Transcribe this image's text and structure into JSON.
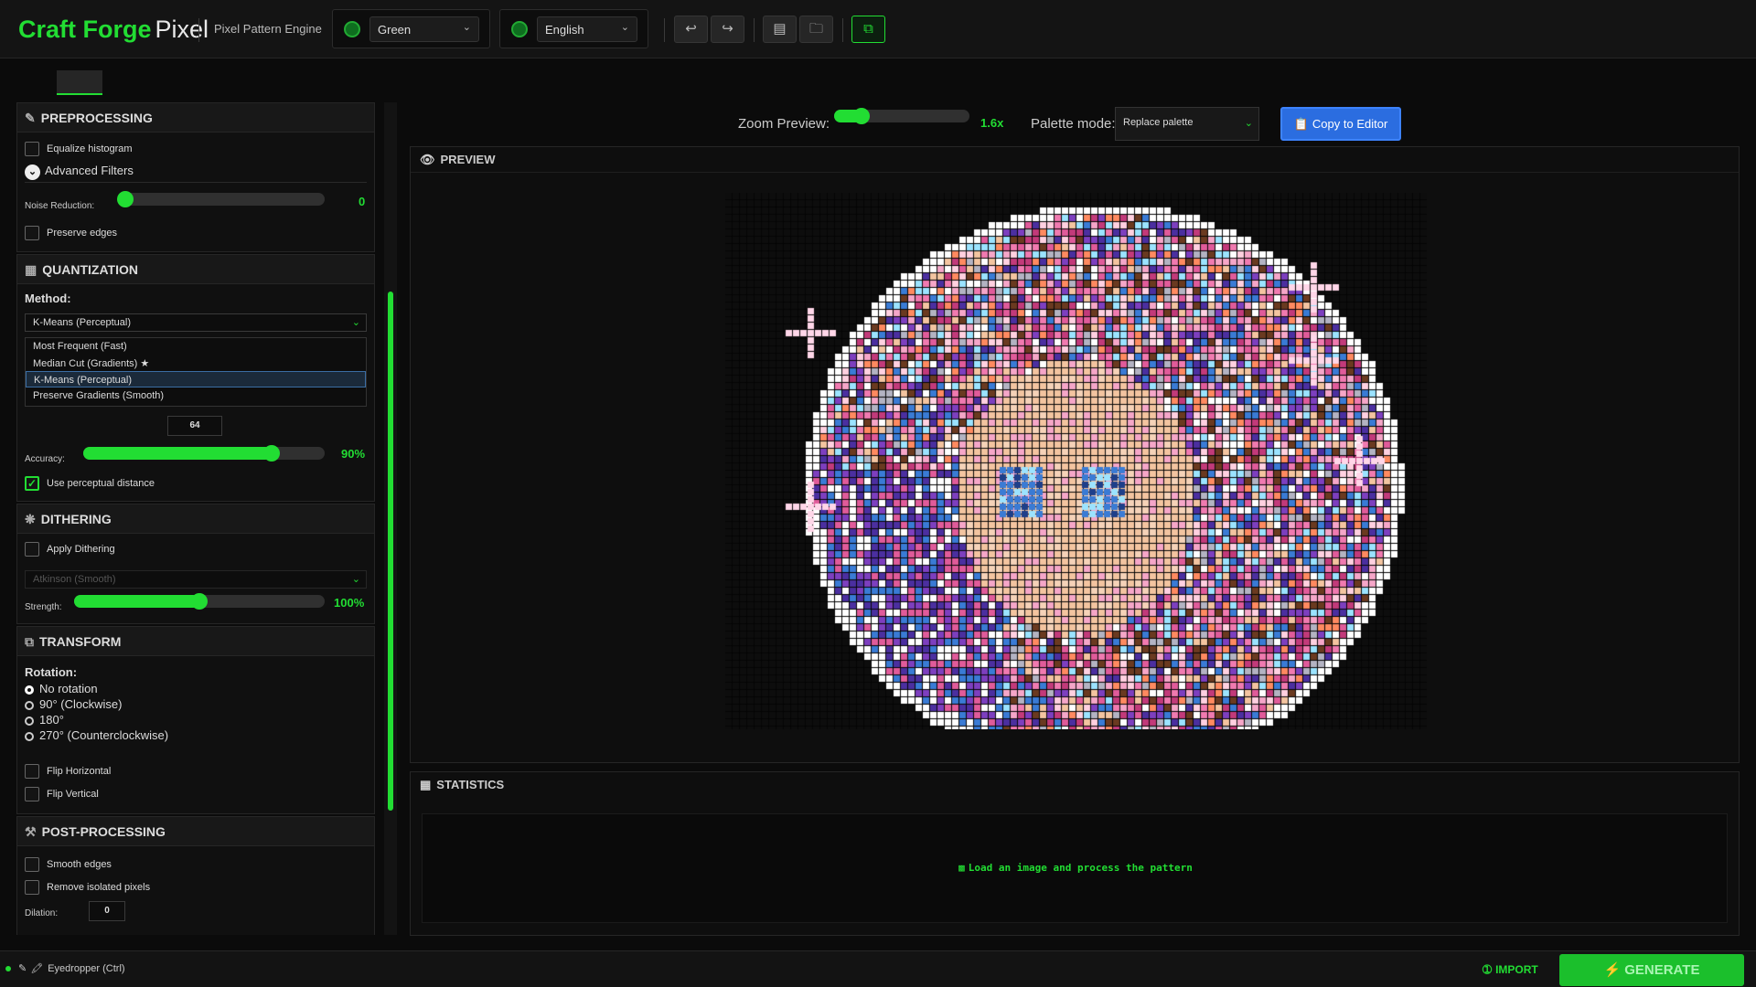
{
  "header": {
    "brand_main": "Craft Forge",
    "brand_sub": "Pixel",
    "subtitle": "Pixel Pattern Engine",
    "theme_select": "Green",
    "language_select": "English",
    "icons": [
      "undo-icon",
      "redo-icon",
      "save-icon",
      "folder-icon",
      "window-icon"
    ]
  },
  "preprocessing": {
    "title": "PREPROCESSING",
    "equalize": "Equalize histogram",
    "advanced": "Advanced Filters",
    "noise_label": "Noise Reduction:",
    "noise_value": "0",
    "noise_level": 0,
    "preserve_edges": "Preserve edges"
  },
  "quantization": {
    "title": "QUANTIZATION",
    "method_label": "Method:",
    "method_selected": "K-Means (Perceptual)",
    "options": [
      "Most Frequent (Fast)",
      "Median Cut (Gradients) ★",
      "K-Means (Perceptual)",
      "Preserve Gradients (Smooth)"
    ],
    "colors": "64",
    "accuracy_label": "Accuracy:",
    "accuracy_value": "90%",
    "accuracy_level": 0.78,
    "perceptual": "Use perceptual distance"
  },
  "dithering": {
    "title": "DITHERING",
    "apply": "Apply Dithering",
    "algorithm": "Atkinson (Smooth)",
    "strength_label": "Strength:",
    "strength_value": "100%",
    "strength_level": 0.5
  },
  "transform": {
    "title": "TRANSFORM",
    "rotation_label": "Rotation:",
    "rotations": [
      "No rotation",
      "90° (Clockwise)",
      "180°",
      "270° (Counterclockwise)"
    ],
    "flip_h": "Flip Horizontal",
    "flip_v": "Flip Vertical"
  },
  "postprocessing": {
    "title": "POST-PROCESSING",
    "smooth": "Smooth edges",
    "remove_isolated": "Remove isolated pixels",
    "dilation_label": "Dilation:",
    "dilation_value": "0"
  },
  "preview_controls": {
    "zoom_label": "Zoom Preview:",
    "zoom_value": "1.6x",
    "zoom_level": 0.2,
    "palette_label": "Palette mode:",
    "palette_mode": "Replace palette",
    "copy_button": "Copy to Editor"
  },
  "preview": {
    "title": "PREVIEW"
  },
  "statistics": {
    "title": "STATISTICS",
    "message": "Load an image and process the pattern"
  },
  "footer": {
    "status": "Eyedropper (Ctrl)",
    "import": "IMPORT",
    "generate": "GENERATE"
  },
  "colors": {
    "accent": "#22dd33",
    "blue": "#2b6de0",
    "background": "#0b0b0b"
  }
}
